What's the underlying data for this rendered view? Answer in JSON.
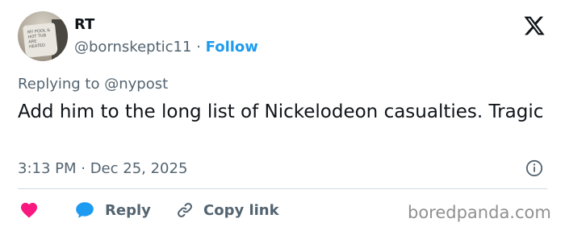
{
  "author": {
    "display_name": "RT",
    "handle": "@bornskeptic11",
    "separator": "·",
    "follow_label": "Follow",
    "avatar_text": "MY POOL & HOT TUB ARE HEATED"
  },
  "reply_context": {
    "prefix": "Replying to",
    "mention": "@nypost"
  },
  "tweet": {
    "text": "Add him to the long list of Nickelodeon casualties. Tragic",
    "timestamp": "3:13 PM · Dec 25, 2025"
  },
  "actions": {
    "like_icon": "heart-icon",
    "reply_label": "Reply",
    "copy_link_label": "Copy link"
  },
  "watermark": "boredpanda.com",
  "colors": {
    "accent": "#1d9bf0",
    "like": "#f91880",
    "muted_text": "#536471",
    "text": "#0f1419"
  }
}
